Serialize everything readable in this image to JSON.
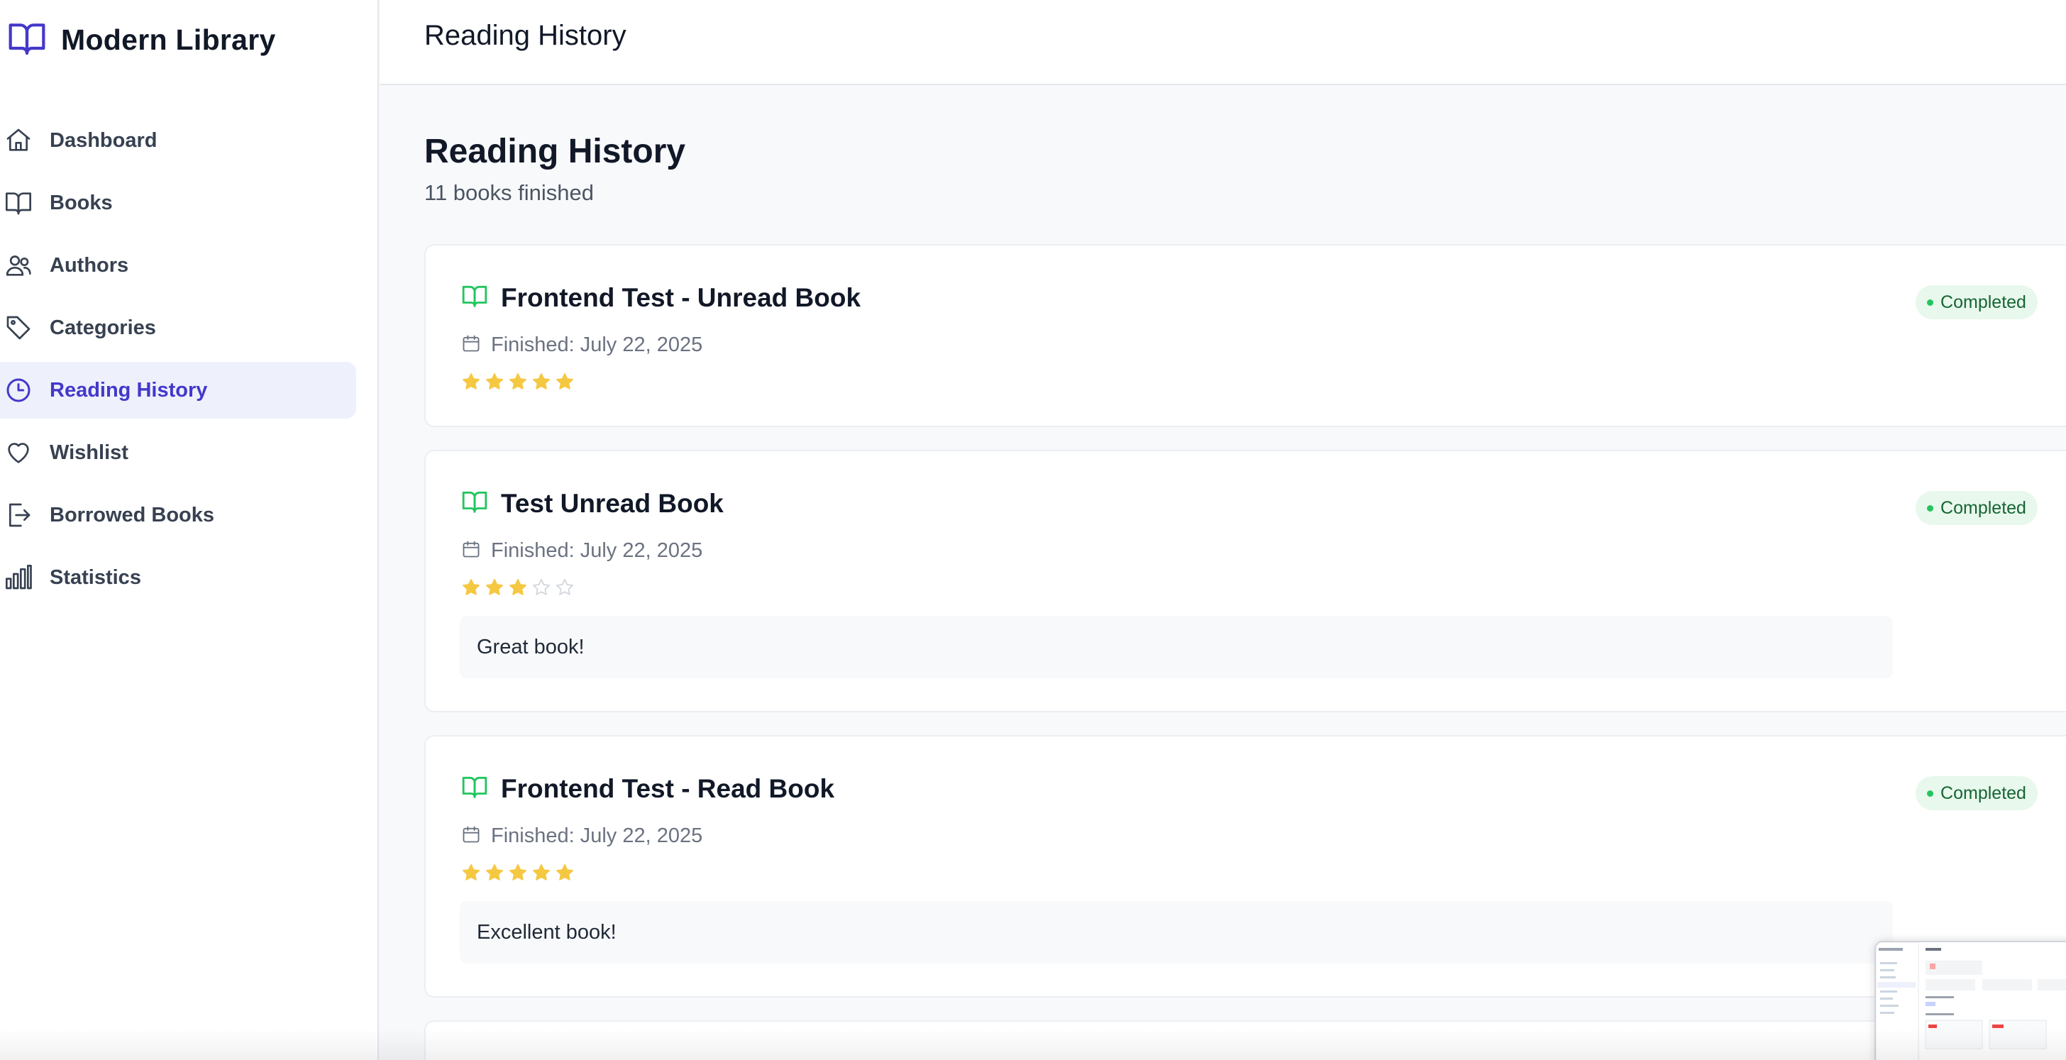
{
  "app": {
    "name": "Modern Library",
    "accent": "#4338ca",
    "active_bg": "#eef0fc"
  },
  "sidebar": {
    "items": [
      {
        "label": "Dashboard",
        "icon": "home-icon"
      },
      {
        "label": "Books",
        "icon": "book-icon"
      },
      {
        "label": "Authors",
        "icon": "users-icon"
      },
      {
        "label": "Categories",
        "icon": "tag-icon"
      },
      {
        "label": "Reading History",
        "icon": "clock-icon",
        "active": true
      },
      {
        "label": "Wishlist",
        "icon": "heart-icon"
      },
      {
        "label": "Borrowed Books",
        "icon": "logout-icon"
      },
      {
        "label": "Statistics",
        "icon": "bar-chart-icon"
      }
    ]
  },
  "header": {
    "title": "Reading History"
  },
  "main": {
    "title": "Reading History",
    "subtitle": "11 books finished",
    "entries": [
      {
        "title": "Frontend Test - Unread Book",
        "finished": "Finished: July 22, 2025",
        "rating": 5,
        "status": "Completed",
        "review": ""
      },
      {
        "title": "Test Unread Book",
        "finished": "Finished: July 22, 2025",
        "rating": 3,
        "status": "Completed",
        "review": "Great book!"
      },
      {
        "title": "Frontend Test - Read Book",
        "finished": "Finished: July 22, 2025",
        "rating": 5,
        "status": "Completed",
        "review": "Excellent book!"
      }
    ]
  },
  "colors": {
    "star_filled": "#f5c842",
    "star_empty": "#d1d5db",
    "book_icon_green": "#22c55e",
    "badge_bg": "#e8f8ec",
    "badge_text": "#166534"
  }
}
